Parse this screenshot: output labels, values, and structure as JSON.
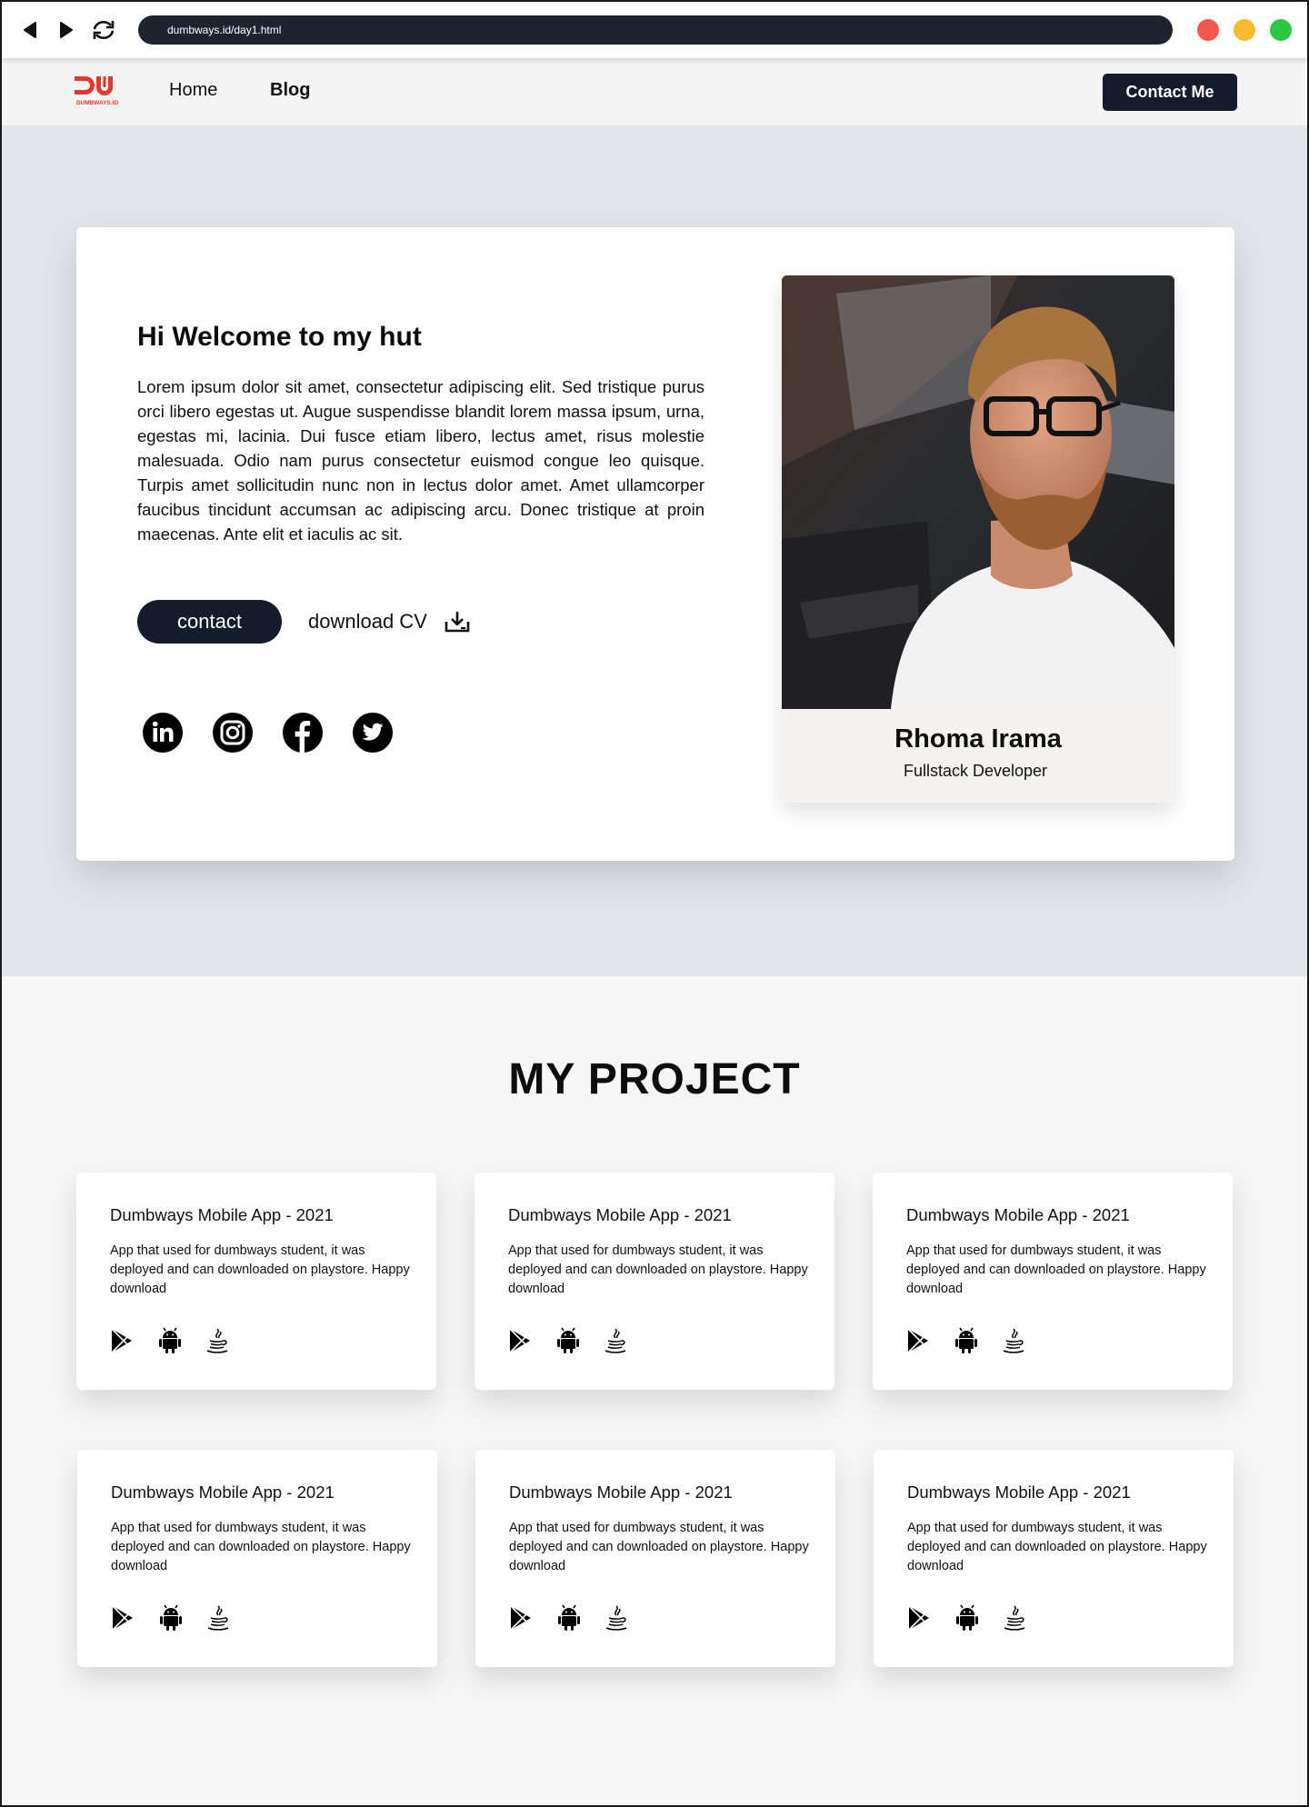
{
  "browser": {
    "url": "dumbways.id/day1.html"
  },
  "navbar": {
    "logo_text": "DUMBWAYS.ID",
    "links": [
      "Home",
      "Blog"
    ],
    "contact_label": "Contact Me"
  },
  "hero": {
    "title": "Hi Welcome to my hut",
    "text": "Lorem ipsum dolor sit amet, consectetur adipiscing elit. Sed tristique purus orci libero egestas ut. Augue suspendisse blandit lorem massa ipsum, urna, egestas mi, lacinia. Dui fusce etiam libero, lectus amet, risus molestie malesuada. Odio nam purus consectetur euismod congue leo quisque. Turpis amet sollicitudin nunc non in lectus dolor amet. Amet ullamcorper faucibus tincidunt accumsan ac adipiscing arcu. Donec tristique at proin maecenas. Ante elit et iaculis ac sit.",
    "contact_button": "contact",
    "download_label": "download CV",
    "socials": [
      "linkedin-icon",
      "instagram-icon",
      "facebook-icon",
      "twitter-icon"
    ]
  },
  "profile": {
    "name": "Rhoma Irama",
    "role": "Fullstack Developer"
  },
  "projects": {
    "title": "MY PROJECT",
    "items": [
      {
        "title": "Dumbways Mobile App - 2021",
        "desc": "App that used for dumbways student, it was deployed and can downloaded on playstore. Happy download"
      },
      {
        "title": "Dumbways Mobile App - 2021",
        "desc": "App that used for dumbways student, it was deployed and can downloaded on playstore. Happy download"
      },
      {
        "title": "Dumbways Mobile App - 2021",
        "desc": "App that used for dumbways student, it was deployed and can downloaded on playstore. Happy download"
      },
      {
        "title": "Dumbways Mobile App - 2021",
        "desc": "App that used for dumbways student, it was deployed and can downloaded on playstore. Happy download"
      },
      {
        "title": "Dumbways Mobile App - 2021",
        "desc": "App that used for dumbways student, it was deployed and can downloaded on playstore. Happy download"
      },
      {
        "title": "Dumbways Mobile App - 2021",
        "desc": "App that used for dumbways student, it was deployed and can downloaded on playstore. Happy download"
      }
    ],
    "tech_icons": [
      "play-store-icon",
      "android-icon",
      "java-icon"
    ]
  },
  "colors": {
    "dark": "#141b2b",
    "hero_bg": "#e2e5ea",
    "page_bg": "#f6f6f6",
    "logo_red": "#e1372c"
  }
}
